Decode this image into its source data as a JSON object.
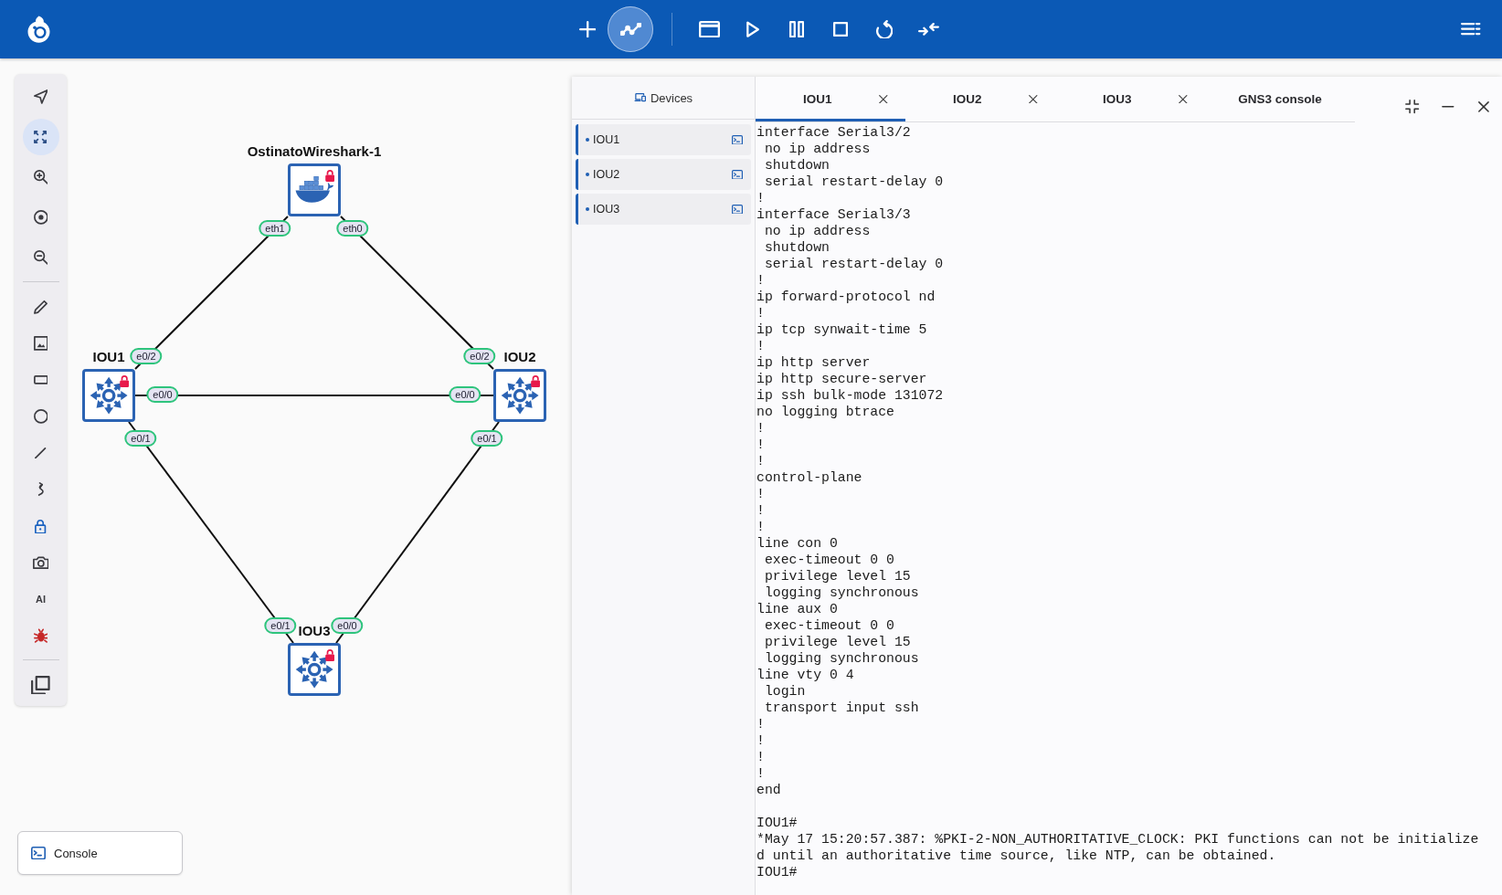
{
  "toolbar": [
    [
      {
        "kind": "add",
        "selected": false
      },
      {
        "kind": "chart",
        "selected": true
      }
    ],
    [
      {
        "kind": "window",
        "selected": false
      },
      {
        "kind": "play",
        "selected": false
      },
      {
        "kind": "pause",
        "selected": false
      },
      {
        "kind": "stop",
        "selected": false
      },
      {
        "kind": "reload",
        "selected": false
      },
      {
        "kind": "collapse",
        "selected": false
      }
    ]
  ],
  "tools": [
    [
      {
        "kind": "pointer",
        "selected": false
      },
      {
        "kind": "fit",
        "selected": true
      },
      {
        "kind": "zoomin",
        "selected": false
      },
      {
        "kind": "center",
        "selected": false
      },
      {
        "kind": "zoomout",
        "selected": false
      }
    ],
    [
      {
        "kind": "pencil",
        "selected": false
      },
      {
        "kind": "image",
        "selected": false
      },
      {
        "kind": "rectangle",
        "selected": false
      },
      {
        "kind": "ellipse",
        "selected": false
      },
      {
        "kind": "line",
        "selected": false
      },
      {
        "kind": "curve",
        "selected": false
      },
      {
        "kind": "lock",
        "selected": false
      },
      {
        "kind": "camera",
        "selected": false
      },
      {
        "kind": "ai",
        "label": "AI",
        "selected": false
      },
      {
        "kind": "bug",
        "selected": false
      }
    ],
    [
      {
        "kind": "layers",
        "selected": false
      }
    ]
  ],
  "canvas": {
    "nodes": [
      {
        "name": "OstinatoWireshark-1",
        "kind": "docker",
        "locked": true
      },
      {
        "name": "IOU1",
        "kind": "switch",
        "locked": true
      },
      {
        "name": "IOU2",
        "kind": "switch",
        "locked": true
      },
      {
        "name": "IOU3",
        "kind": "switch",
        "locked": true
      }
    ],
    "links": [
      {
        "ports": [
          "eth1",
          "e0/2"
        ]
      },
      {
        "ports": [
          "eth0",
          "e0/2"
        ]
      },
      {
        "ports": [
          "e0/0",
          "e0/0"
        ]
      },
      {
        "ports": [
          "e0/1",
          "e0/1"
        ]
      },
      {
        "ports": [
          "e0/1",
          "e0/0"
        ]
      }
    ]
  },
  "console_button": {
    "label": "Console"
  },
  "devices": {
    "title": "Devices",
    "items": [
      {
        "name": "IOU1"
      },
      {
        "name": "IOU2"
      },
      {
        "name": "IOU3"
      }
    ]
  },
  "console_tabs": [
    {
      "label": "IOU1",
      "selected": true,
      "closable": true
    },
    {
      "label": "IOU2",
      "selected": false,
      "closable": true
    },
    {
      "label": "IOU3",
      "selected": false,
      "closable": true
    },
    {
      "label": "GNS3 console",
      "selected": false,
      "closable": false
    }
  ],
  "terminal": {
    "blocks": [
      [
        "interface Serial3/2",
        " no ip address",
        " shutdown",
        " serial restart-delay 0",
        "!",
        "interface Serial3/3",
        " no ip address",
        " shutdown",
        " serial restart-delay 0",
        "!",
        "ip forward-protocol nd",
        "!",
        "ip tcp synwait-time 5",
        "!",
        "ip http server",
        "ip http secure-server",
        "ip ssh bulk-mode 131072",
        "no logging btrace",
        "!",
        "!",
        "!",
        "control-plane",
        "!",
        "!",
        "!",
        "line con 0",
        " exec-timeout 0 0",
        " privilege level 15",
        " logging synchronous",
        "line aux 0",
        " exec-timeout 0 0",
        " privilege level 15",
        " logging synchronous",
        "line vty 0 4",
        " login",
        " transport input ssh",
        "!",
        "!",
        "!",
        "!",
        "end"
      ],
      [
        "IOU1#",
        "*May 17 15:20:57.387: %PKI-2-NON_AUTHORITATIVE_CLOCK: PKI functions can not be initialize",
        "d until an authoritative time source, like NTP, can be obtained.",
        "IOU1#"
      ]
    ]
  }
}
